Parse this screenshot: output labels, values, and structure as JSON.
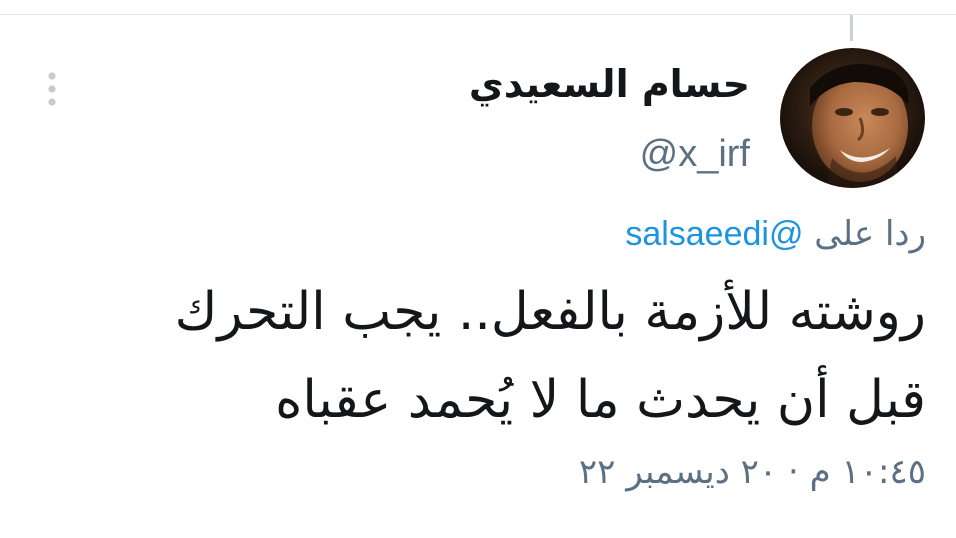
{
  "tweet": {
    "author": {
      "display_name": "حسام السعيدي",
      "handle": "@x_irf",
      "avatar": "profile-photo"
    },
    "reply_to": {
      "prefix": "ردا على",
      "mention": "@salsaeedi"
    },
    "text_lines": [
      "روشته للأزمة بالفعل.. يجب التحرك",
      "قبل أن يحدث ما لا يُحمد عقباه"
    ],
    "timestamp": "١٠:٤٥ م · ٢٠ ديسمبر ٢٢",
    "menu_icon": "more-vertical-icon"
  },
  "colors": {
    "text_primary": "#14171a",
    "text_secondary": "#5b7083",
    "link": "#1b95e0",
    "divider": "#e3e6ea"
  }
}
